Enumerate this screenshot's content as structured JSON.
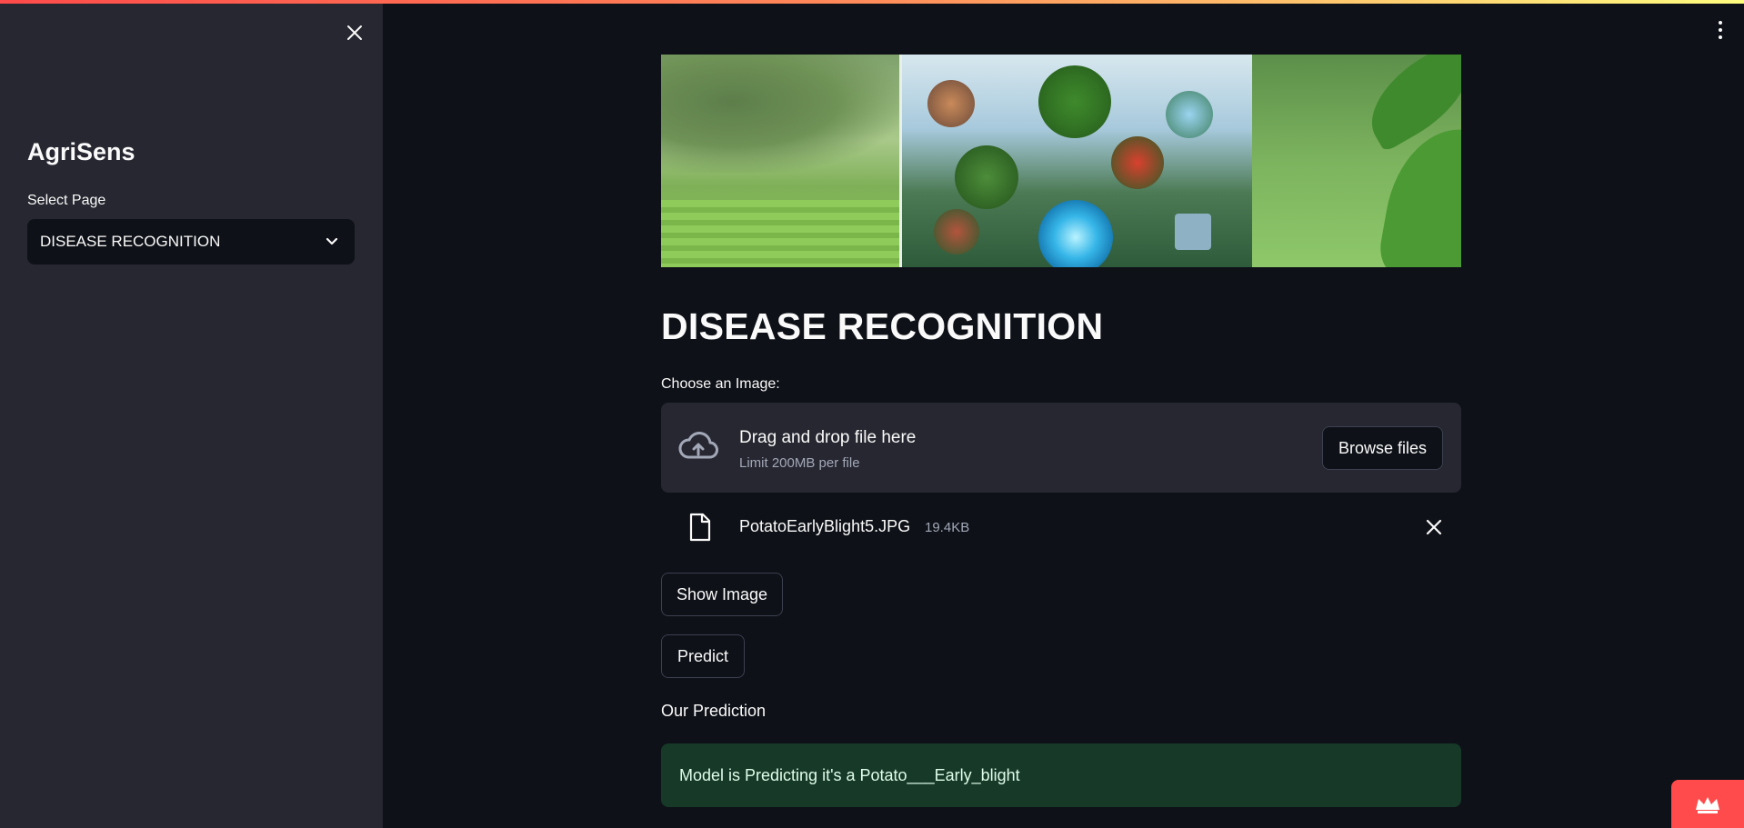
{
  "sidebar": {
    "title": "AgriSens",
    "select_label": "Select Page",
    "selected_page": "DISEASE RECOGNITION"
  },
  "main": {
    "page_title": "DISEASE RECOGNITION",
    "uploader": {
      "label": "Choose an Image:",
      "drop_text": "Drag and drop file here",
      "limit_text": "Limit 200MB per file",
      "browse_label": "Browse files"
    },
    "uploaded_file": {
      "name": "PotatoEarlyBlight5.JPG",
      "size": "19.4KB"
    },
    "buttons": {
      "show_image": "Show Image",
      "predict": "Predict"
    },
    "prediction_label": "Our Prediction",
    "prediction_result": "Model is Predicting it's a Potato___Early_blight"
  },
  "theme": {
    "accent": "#ff4b4b",
    "background": "#0e1117",
    "sidebar_bg": "#262730",
    "success_bg": "#173928"
  },
  "icons": {
    "sidebar_close": "close-icon",
    "select_arrow": "chevron-down-icon",
    "upload": "cloud-upload-icon",
    "file": "file-icon",
    "remove_file": "close-icon",
    "main_menu": "kebab-menu-icon",
    "badge": "crown-icon"
  }
}
